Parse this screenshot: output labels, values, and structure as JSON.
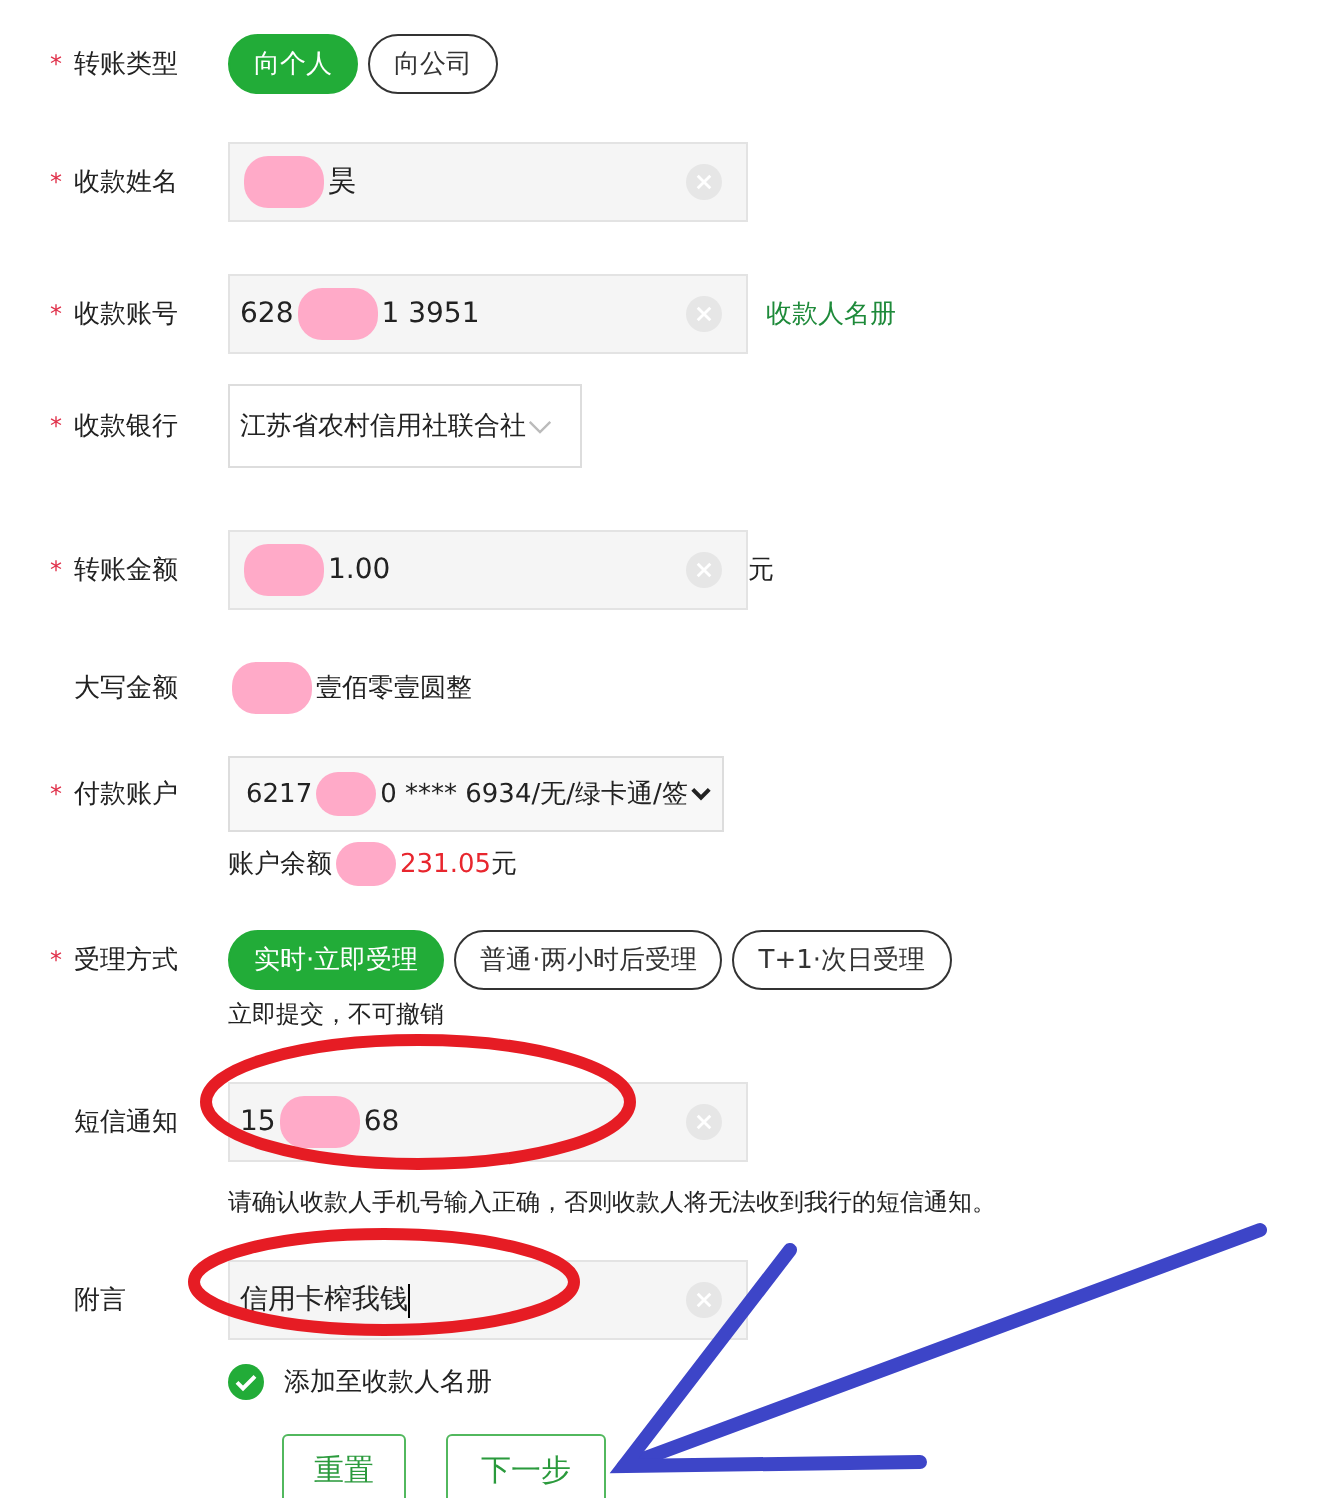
{
  "required_mark": "*",
  "rows": [
    {
      "kind": "choice",
      "label": "转账类型",
      "required": true,
      "options": [
        {
          "label": "向个人",
          "selected": true
        },
        {
          "label": "向公司",
          "selected": false
        }
      ]
    },
    {
      "kind": "input",
      "label": "收款姓名",
      "required": true,
      "value": [
        {
          "kind": "redaction"
        },
        {
          "kind": "text",
          "text": "昊"
        }
      ]
    },
    {
      "kind": "input",
      "label": "收款账号",
      "required": true,
      "value": [
        {
          "kind": "text",
          "text": "628"
        },
        {
          "kind": "redaction"
        },
        {
          "kind": "text",
          "text": "1 3951"
        }
      ],
      "link": "收款人名册"
    },
    {
      "kind": "bank",
      "label": "收款银行",
      "required": true,
      "value": [
        {
          "kind": "text",
          "text": "江苏省农村信用社联合社"
        }
      ]
    },
    {
      "kind": "input",
      "label": "转账金额",
      "required": true,
      "value": [
        {
          "kind": "redaction"
        },
        {
          "kind": "text",
          "text": "1.00"
        }
      ],
      "unit": "元"
    },
    {
      "kind": "text",
      "label": "大写金额",
      "required": false,
      "value": [
        {
          "kind": "redaction"
        },
        {
          "kind": "text",
          "text": "壹佰零壹圆整"
        }
      ]
    },
    {
      "kind": "select",
      "label": "付款账户",
      "required": true,
      "value": [
        {
          "kind": "text",
          "text": "6217"
        },
        {
          "kind": "redaction"
        },
        {
          "kind": "text",
          "text": "0 **** 6934/无/绿卡通/签"
        }
      ],
      "balance": {
        "label": "账户余额",
        "amount": "231.05",
        "unit": "元"
      }
    },
    {
      "kind": "choice",
      "label": "受理方式",
      "required": true,
      "options": [
        {
          "label": "实时·立即受理",
          "selected": true
        },
        {
          "label": "普通·两小时后受理",
          "selected": false
        },
        {
          "label": "T+1·次日受理",
          "selected": false
        }
      ],
      "note": "立即提交，不可撤销"
    },
    {
      "kind": "input",
      "label": "短信通知",
      "required": false,
      "value": [
        {
          "kind": "text",
          "text": "15"
        },
        {
          "kind": "redaction"
        },
        {
          "kind": "text",
          "text": "68"
        }
      ],
      "note": "请确认收款人手机号输入正确，否则收款人将无法收到我行的短信通知。"
    },
    {
      "kind": "input",
      "label": "附言",
      "required": false,
      "value": [
        {
          "kind": "text",
          "text": "信用卡榨我钱"
        }
      ],
      "caret": true
    }
  ],
  "add_to_payees": {
    "label": "添加至收款人名册",
    "checked": true
  },
  "buttons": [
    "重置",
    "下一步"
  ],
  "annotations": [
    {
      "kind": "ellipse"
    },
    {
      "kind": "ellipse"
    },
    {
      "kind": "arrow"
    }
  ]
}
